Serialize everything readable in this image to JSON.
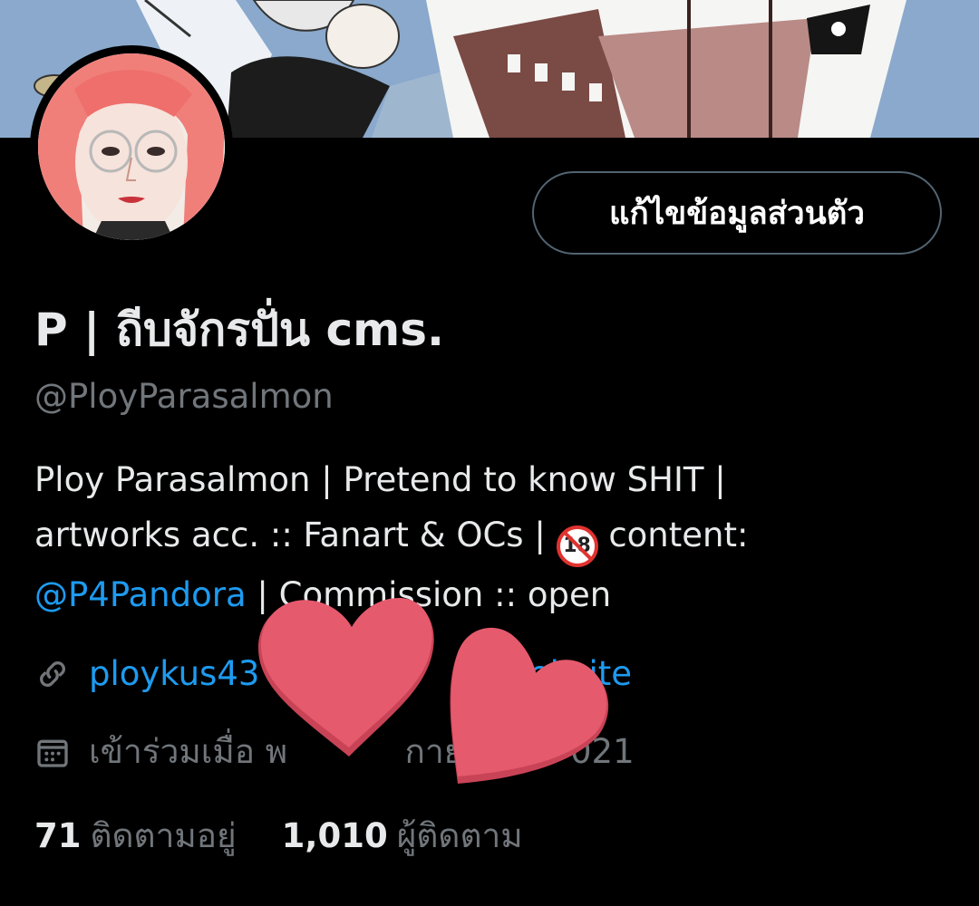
{
  "profile": {
    "display_name": "P | ถีบจักรปั่น cms.",
    "handle": "@PloyParasalmon",
    "bio_line1": "Ploy Parasalmon | Pretend to know SHIT |",
    "bio_line2_a": "artworks acc. :: Fanart & OCs |",
    "bio_badge": "18",
    "bio_line2_b": "content:",
    "bio_mention": "@P4Pandora",
    "bio_line3_rest": " | Commission :: open",
    "website": "ploykus43          .c          website",
    "joined": "เข้าร่วมเมื่อ พ           กาย          021",
    "following_count": "71",
    "following_label": "ติดตามอยู่",
    "followers_count": "1,010",
    "followers_label": "ผู้ติดตาม"
  },
  "actions": {
    "edit_profile_label": "แก้ไขข้อมูลส่วนตัว"
  },
  "icons": {
    "link": "link-icon",
    "calendar": "calendar-icon"
  },
  "colors": {
    "background": "#000000",
    "accent_link": "#1d9bf0",
    "muted_text": "#71767b",
    "heart_sticker": "#e65a6e"
  }
}
